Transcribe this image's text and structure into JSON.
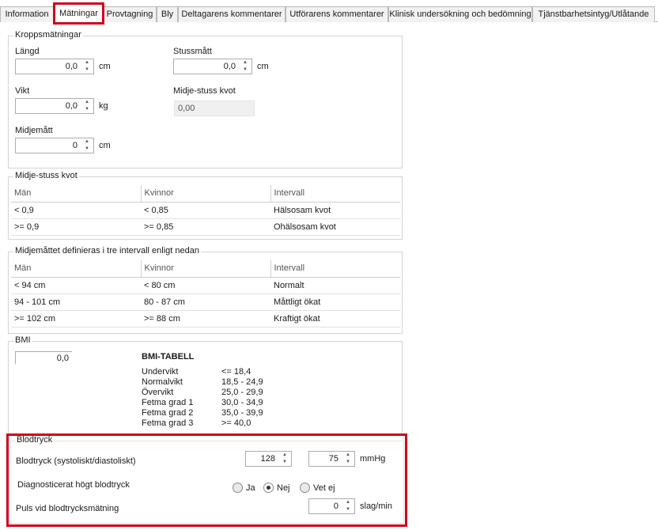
{
  "tabs": [
    {
      "label": "Information"
    },
    {
      "label": "Mätningar"
    },
    {
      "label": "Provtagning"
    },
    {
      "label": "Bly"
    },
    {
      "label": "Deltagarens kommentarer"
    },
    {
      "label": "Utförarens kommentarer"
    },
    {
      "label": "Klinisk undersökning och bedömning"
    },
    {
      "label": "Tjänstbarhetsintyg/Utlåtande"
    }
  ],
  "active_tab": "Mätningar",
  "kropp": {
    "title": "Kroppsmätningar",
    "langd": {
      "label": "Längd",
      "value": "0,0",
      "unit": "cm"
    },
    "stuss": {
      "label": "Stussmått",
      "value": "0,0",
      "unit": "cm"
    },
    "vikt": {
      "label": "Vikt",
      "value": "0,0",
      "unit": "kg"
    },
    "kvot": {
      "label": "Midje-stuss kvot",
      "value": "0,00"
    },
    "midje": {
      "label": "Midjemått",
      "value": "0",
      "unit": "cm"
    }
  },
  "kvot_table": {
    "title": "Midje-stuss kvot",
    "headers": [
      "Män",
      "Kvinnor",
      "Intervall"
    ],
    "rows": [
      [
        "< 0,9",
        "< 0,85",
        "Hälsosam kvot"
      ],
      [
        ">= 0,9",
        ">= 0,85",
        "Ohälsosam kvot"
      ]
    ]
  },
  "midje_table": {
    "title": "Midjemåttet definieras i tre intervall enligt nedan",
    "headers": [
      "Män",
      "Kvinnor",
      "Intervall"
    ],
    "rows": [
      [
        "< 94 cm",
        "< 80 cm",
        "Normalt"
      ],
      [
        "94 - 101 cm",
        "80 - 87 cm",
        "Måttligt ökat"
      ],
      [
        ">= 102 cm",
        ">= 88 cm",
        "Kraftigt ökat"
      ]
    ]
  },
  "bmi": {
    "title": "BMI",
    "value": "0,0",
    "table_title": "BMI-TABELL",
    "rows": [
      [
        "Undervikt",
        "<= 18,4"
      ],
      [
        "Normalvikt",
        "18,5 - 24,9"
      ],
      [
        "Övervikt",
        "25,0 - 29,9"
      ],
      [
        "Fetma grad 1",
        "30,0 - 34,9"
      ],
      [
        "Fetma grad 2",
        "35,0 - 39,9"
      ],
      [
        "Fetma grad 3",
        ">= 40,0"
      ]
    ]
  },
  "blod": {
    "title": "Blodtryck",
    "bp_label": "Blodtryck (systoliskt/diastoliskt)",
    "systolic": "128",
    "diastolic": "75",
    "bp_unit": "mmHg",
    "diag_label": "Diagnosticerat högt blodtryck",
    "options": [
      "Ja",
      "Nej",
      "Vet ej"
    ],
    "selected": "Nej",
    "puls_label": "Puls vid blodtrycksmätning",
    "puls_value": "0",
    "puls_unit": "slag/min"
  }
}
